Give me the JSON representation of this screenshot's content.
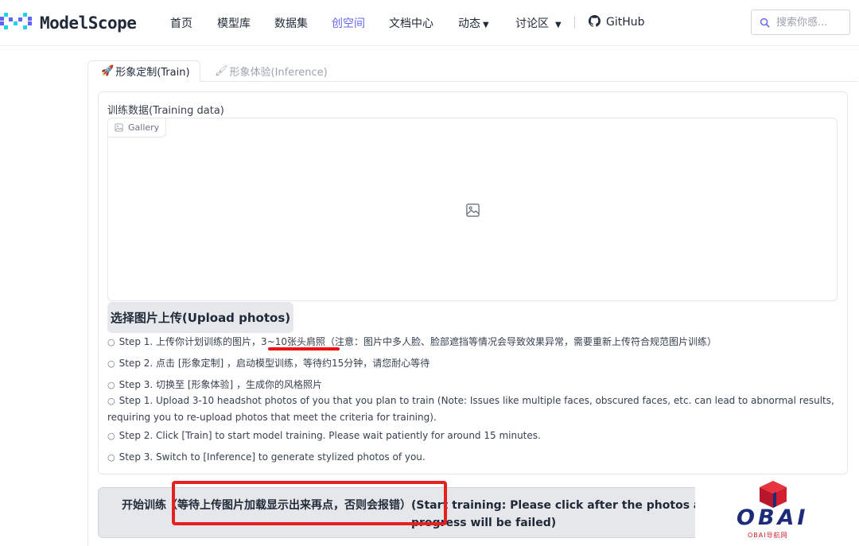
{
  "nav": {
    "brand": "ModelScope",
    "items": [
      {
        "label": "首页"
      },
      {
        "label": "模型库"
      },
      {
        "label": "数据集"
      },
      {
        "label": "创空间"
      },
      {
        "label": "文档中心"
      },
      {
        "label": "动态"
      },
      {
        "label": "讨论区"
      },
      {
        "label": "GitHub"
      }
    ],
    "active_color": "#6366f1",
    "search_placeholder": "搜索你感..."
  },
  "tabs": [
    {
      "label": "形象定制(Train)",
      "icon": "rocket-icon",
      "emoji": "🚀"
    },
    {
      "label": "形象体验(Inference)",
      "icon": "paintbrush-icon",
      "emoji": "🖌"
    }
  ],
  "train": {
    "field_label": "训练数据(Training data)",
    "gallery_label": "Gallery",
    "upload_button": "选择图片上传(Upload photos)",
    "steps_cn": [
      {
        "before": "Step 1. 上传你计划训练的图片，",
        "highlight": "3~10张头肩照",
        "after": "（注意：图片中多人脸、脸部遮挡等情况会导致效果异常，需要重新上传符合规范图片训练）"
      },
      {
        "text": "Step 2. 点击 [形象定制] ，启动模型训练，等待约15分钟，请您耐心等待"
      },
      {
        "text": "Step 3. 切换至 [形象体验] ，生成你的风格照片"
      }
    ],
    "steps_en": [
      {
        "text": "Step 1. Upload 3-10 headshot photos of you that you plan to train (Note: Issues like multiple faces, obscured faces, etc. can lead to abnormal results, requiring you to re-upload photos that meet the criteria for training)."
      },
      {
        "text": "Step 2. Click [Train] to start model training. Please wait patiently for around 15 minutes."
      },
      {
        "text": "Step 3. Switch to [Inference] to generate stylized photos of you."
      }
    ],
    "start_button": {
      "prefix": "开始训练",
      "boxed": "（等待上传图片加载显示出来再点，否则会报错）",
      "suffix": "(Start training: Please click after the photos are",
      "line2": "progress will be failed)"
    },
    "annotation_color": "#e52020"
  },
  "watermark": {
    "title": "OBAI",
    "subtitle": "OBAI导航网",
    "colors": {
      "text": "#1e2a7a",
      "cube": "#d21e2e"
    }
  }
}
